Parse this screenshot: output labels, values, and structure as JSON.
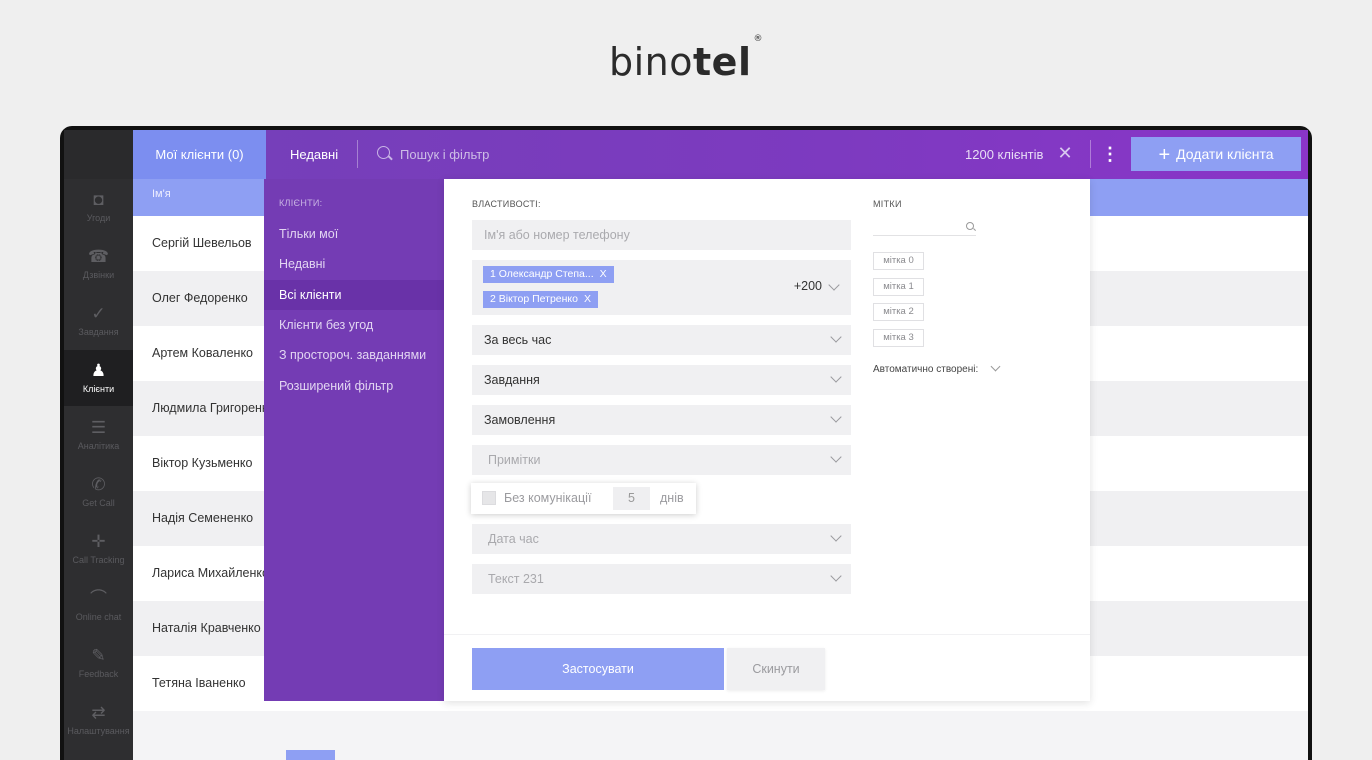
{
  "logo": {
    "text_regular": "bino",
    "text_bold": "tel",
    "mark": "®"
  },
  "sidebar": {
    "items": [
      {
        "label": "Угоди",
        "icon": "deals-icon",
        "glyph": "◘",
        "active": false
      },
      {
        "label": "Дзвінки",
        "icon": "phone-icon",
        "glyph": "☎",
        "active": false
      },
      {
        "label": "Завдання",
        "icon": "check-icon",
        "glyph": "✓",
        "active": false
      },
      {
        "label": "Клієнти",
        "icon": "user-icon",
        "glyph": "♟",
        "active": true
      },
      {
        "label": "Аналітика",
        "icon": "analytics-icon",
        "glyph": "☰",
        "active": false
      },
      {
        "label": "Get Call",
        "icon": "getcall-icon",
        "glyph": "✆",
        "active": false
      },
      {
        "label": "Call Tracking",
        "icon": "calltracking-icon",
        "glyph": "✛",
        "active": false
      },
      {
        "label": "Online chat",
        "icon": "chat-icon",
        "glyph": "⌒",
        "active": false
      },
      {
        "label": "Feedback",
        "icon": "feedback-icon",
        "glyph": "✎",
        "active": false
      },
      {
        "label": "Налаштування",
        "icon": "settings-icon",
        "glyph": "⇄",
        "active": false
      }
    ]
  },
  "topbar": {
    "tab_mine": "Мої клієнти (0)",
    "tab_recent": "Недавні",
    "search_placeholder": "Пошук і фільтр",
    "count": "1200 клієнтів",
    "clear": "✕",
    "more": "⋮",
    "add_button": "Додати клієнта",
    "add_plus": "+"
  },
  "table": {
    "header_name": "Ім'я",
    "rows": [
      "Сергій Шевельов",
      "Олег Федоренко",
      "Артем Коваленко",
      "Людмила Григоренко",
      "Віктор Кузьменко",
      "Надія Семененко",
      "Лариса Михайленко",
      "Наталія Кравченко",
      "Тетяна Іваненко"
    ]
  },
  "filter": {
    "clients_title": "КЛІЄНТИ:",
    "client_options": [
      "Тільки мої",
      "Недавні",
      "Всі клієнти",
      "Клієнти без угод",
      "З простороч. завданнями",
      "Розширений фільтр"
    ],
    "active_option": 2,
    "props_title": "ВЛАСТИВОСТІ:",
    "name_placeholder": "Ім'я або номер телефону",
    "chips": [
      "1 Олександр Степа...",
      "2 Віктор Петренко"
    ],
    "chip_close": "X",
    "chips_more": "+200",
    "selects": [
      {
        "label": "За весь час",
        "muted": false
      },
      {
        "label": "Завдання",
        "muted": false
      },
      {
        "label": "Замовлення",
        "muted": false
      },
      {
        "label": "Примітки",
        "muted": true
      },
      {
        "label": "Дата час",
        "muted": true
      },
      {
        "label": "Текст 231",
        "muted": true
      }
    ],
    "no_comm_label": "Без комунікації",
    "no_comm_value": "5",
    "no_comm_unit": "днів",
    "apply": "Застосувати",
    "reset": "Скинути",
    "tags_title": "МІТКИ",
    "tags": [
      "мітка 0",
      "мітка 1",
      "мітка 2",
      "мітка 3"
    ],
    "auto_created": "Автоматично створені:"
  },
  "colors": {
    "topbar": "#7d3ac0",
    "accent": "#8e9ff3",
    "filter_panel": "#743cb4",
    "sidebar": "#2e2e30"
  }
}
